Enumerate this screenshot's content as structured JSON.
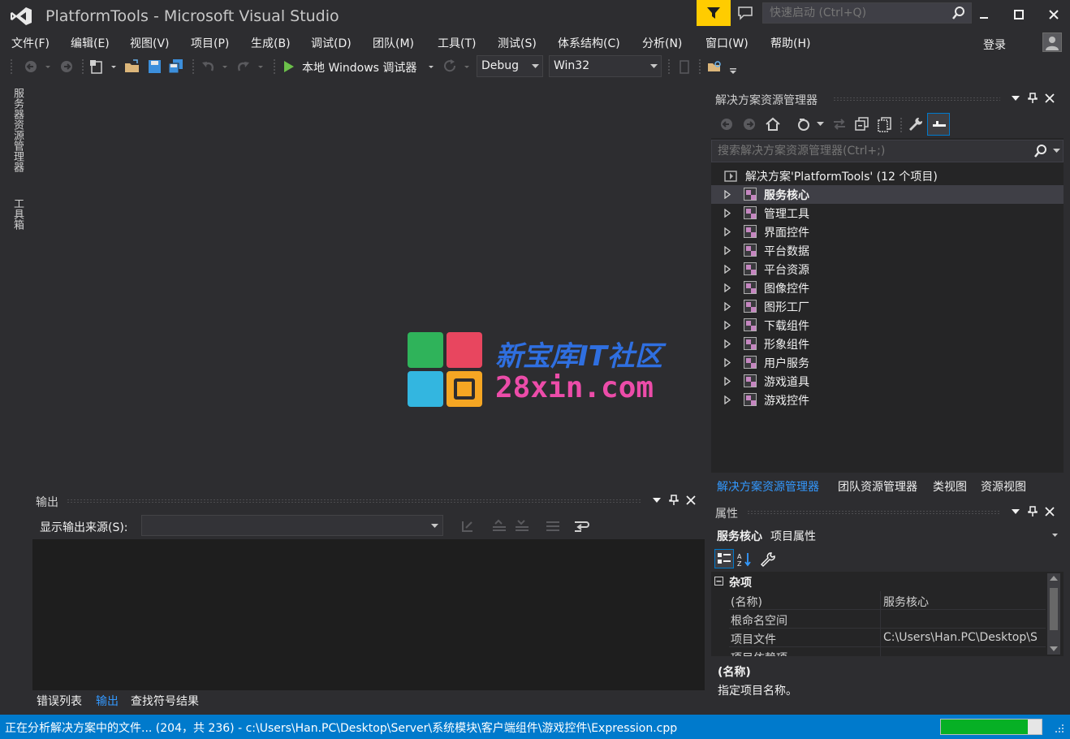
{
  "app": {
    "title": "PlatformTools - Microsoft Visual Studio"
  },
  "quick_launch": {
    "placeholder": "快速启动 (Ctrl+Q)"
  },
  "menu": [
    "文件(F)",
    "编辑(E)",
    "视图(V)",
    "项目(P)",
    "生成(B)",
    "调试(D)",
    "团队(M)",
    "工具(T)",
    "测试(S)",
    "体系结构(C)",
    "分析(N)",
    "窗口(W)",
    "帮助(H)"
  ],
  "signin": "登录",
  "toolbar": {
    "debugger": "本地 Windows 调试器",
    "config": "Debug",
    "platform": "Win32"
  },
  "left_tabs": {
    "server_explorer": "服务器资源管理器",
    "toolbox": "工具箱"
  },
  "watermark": {
    "line1": "新宝库IT社区",
    "line2": "28xin.com"
  },
  "output": {
    "title": "输出",
    "source_label": "显示输出来源(S):",
    "source_value": "",
    "tabs": [
      "错误列表",
      "输出",
      "查找符号结果"
    ]
  },
  "solution_explorer": {
    "title": "解决方案资源管理器",
    "search_placeholder": "搜索解决方案资源管理器(Ctrl+;)",
    "solution": "解决方案'PlatformTools' (12 个项目)",
    "projects": [
      "服务核心",
      "管理工具",
      "界面控件",
      "平台数据",
      "平台资源",
      "图像控件",
      "图形工厂",
      "下载组件",
      "形象组件",
      "用户服务",
      "游戏道具",
      "游戏控件"
    ],
    "tabs": [
      "解决方案资源管理器",
      "团队资源管理器",
      "类视图",
      "资源视图"
    ]
  },
  "properties": {
    "title": "属性",
    "target_name": "服务核心",
    "target_type": "项目属性",
    "category": "杂项",
    "rows": [
      {
        "name": "(名称)",
        "value": "服务核心"
      },
      {
        "name": "根命名空间",
        "value": ""
      },
      {
        "name": "项目文件",
        "value": "C:\\Users\\Han.PC\\Desktop\\S"
      },
      {
        "name": "项目依赖项",
        "value": ""
      }
    ],
    "desc_title": "(名称)",
    "desc_text": "指定项目名称。"
  },
  "status": {
    "text": "正在分析解决方案中的文件... (204，共 236) - c:\\Users\\Han.PC\\Desktop\\Server\\系统模块\\客户端组件\\游戏控件\\Expression.cpp",
    "progress": 0.864
  },
  "colors": {
    "accent": "#007acc",
    "selection_text": "#3399ff",
    "feedback": "#ffcc00",
    "progress": "#06b025"
  }
}
